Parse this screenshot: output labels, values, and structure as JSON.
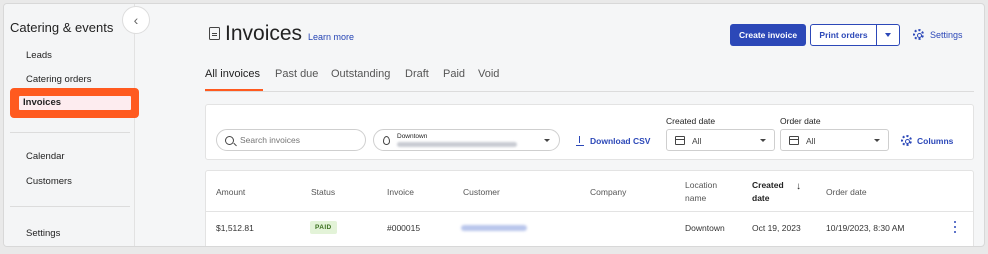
{
  "sidebar": {
    "title": "Catering & events",
    "items": [
      {
        "label": "Leads"
      },
      {
        "label": "Catering orders"
      },
      {
        "label": "Invoices"
      },
      {
        "label": "Calendar"
      },
      {
        "label": "Customers"
      },
      {
        "label": "Settings"
      }
    ],
    "collapse_icon": "chevron-left-icon",
    "highlight_color": "#ff5a1f"
  },
  "header": {
    "title": "Invoices",
    "learn_more": "Learn more",
    "create_invoice": "Create invoice",
    "print_orders": "Print orders",
    "settings": "Settings"
  },
  "tabs": [
    {
      "label": "All invoices",
      "active": true
    },
    {
      "label": "Past due"
    },
    {
      "label": "Outstanding"
    },
    {
      "label": "Draft"
    },
    {
      "label": "Paid"
    },
    {
      "label": "Void"
    }
  ],
  "filters": {
    "search_placeholder": "Search invoices",
    "location_label": "Downtown",
    "download_csv": "Download CSV",
    "created_date_label": "Created date",
    "created_date_value": "All",
    "order_date_label": "Order date",
    "order_date_value": "All",
    "columns": "Columns"
  },
  "table": {
    "headers": {
      "amount": "Amount",
      "status": "Status",
      "invoice": "Invoice",
      "customer": "Customer",
      "company": "Company",
      "location_1": "Location",
      "location_2": "name",
      "created_1": "Created",
      "created_2": "date",
      "order_date": "Order date"
    },
    "rows": [
      {
        "amount": "$1,512.81",
        "status": "PAID",
        "invoice": "#000015",
        "location": "Downtown",
        "created": "Oct 19, 2023",
        "order_date": "10/19/2023, 8:30 AM"
      }
    ]
  },
  "colors": {
    "primary": "#2c48b8",
    "accent": "#ff5a1f",
    "paid_badge_bg": "#e3f3d8"
  }
}
